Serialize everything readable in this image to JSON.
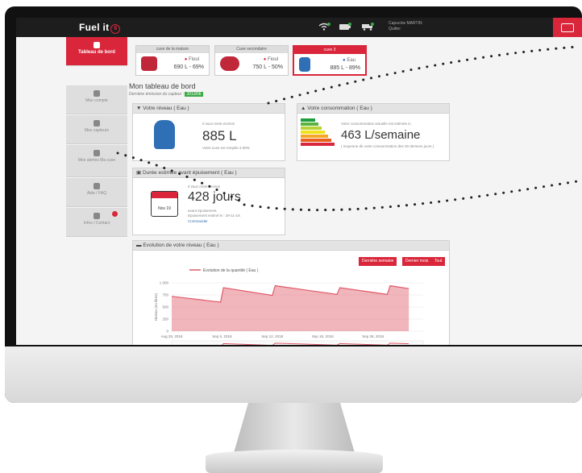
{
  "app": {
    "brand": "Fuel it",
    "brand_mark": "6"
  },
  "user": {
    "name": "Capucine MARTIN",
    "action": "Quitter"
  },
  "sidebar": [
    {
      "label": "Tableau de bord",
      "active": true
    },
    {
      "label": "Mon compte",
      "active": false
    },
    {
      "label": "Mes capteurs",
      "active": false
    },
    {
      "label": "Mes alertes Ma cuve",
      "active": false
    },
    {
      "label": "Aide / FAQ",
      "active": false
    },
    {
      "label": "Infos / Contact",
      "active": false
    }
  ],
  "tanks": [
    {
      "title": "cuve de la maison",
      "type": "Fioul",
      "level": "690 L - 69%"
    },
    {
      "title": "Cuve secondaire",
      "type": "Fioul",
      "level": "750 L - 50%"
    },
    {
      "title": "cuve 3",
      "type": "Eau",
      "level": "885 L - 89%"
    }
  ],
  "dashboard": {
    "title": "Mon tableau de bord",
    "last_emission_label": "Dernière émission du capteur :",
    "last_emission_value": "2013/06"
  },
  "level_panel": {
    "title": "Votre niveau ( Eau )",
    "remaining_label": "Il vous reste environ",
    "value": "885 L",
    "fill_note": "Votre cuve est remplie à 89%"
  },
  "consumption_panel": {
    "title": "Votre consommation ( Eau )",
    "label": "Votre consommation actuelle est estimée à :",
    "value": "463 L/semaine",
    "note": "( moyenne de votre consommation des 30 derniers jours )"
  },
  "duration_panel": {
    "title": "Durée estimée avant épuisement ( Eau )",
    "label": "Il vous reste environ",
    "value": "428 jours",
    "line1": "avant épuisement.",
    "line2": "Epuisement estimé le : 29-11-19.",
    "link": "Commander",
    "calendar_label": "Nov 19"
  },
  "evolution_panel": {
    "title": "Evolution de votre niveau ( Eau )",
    "buttons": [
      "Dernière semaine",
      "Dernier mois",
      "Tout"
    ]
  },
  "chart_data": {
    "type": "area",
    "title": "",
    "ylabel": "Niveau (en litres)",
    "legend": "Evolution de la quantité ( Eau )",
    "ylim": [
      0,
      1000
    ],
    "yticks": [
      0,
      250,
      500,
      750,
      1000
    ],
    "yticklabels": [
      "0",
      "250",
      "500",
      "750",
      "1 000"
    ],
    "xticklabels": [
      "Aug 29, 2018",
      "Sep 5, 2018",
      "Sep 12, 2018",
      "Sep 19, 2018",
      "Sep 26, 2018"
    ],
    "x": [
      0,
      6.8,
      7.2,
      14,
      14.4,
      23,
      23.4,
      30,
      30.4,
      33
    ],
    "series": [
      {
        "values": [
          720,
          600,
          900,
          740,
          940,
          760,
          900,
          760,
          940,
          880
        ]
      }
    ],
    "color": "#e05a6a"
  },
  "colors": {
    "accent": "#d9263a",
    "topbar": "#1d1d1d",
    "sidebar_bg": "#dedede"
  }
}
